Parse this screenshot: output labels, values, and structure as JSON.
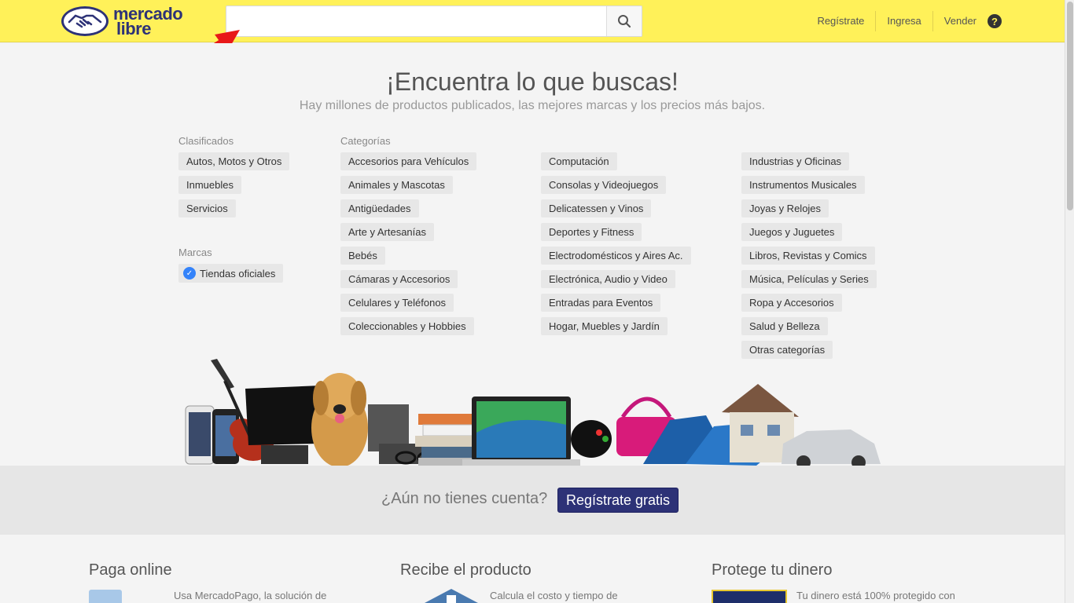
{
  "header": {
    "logo_line1": "mercado",
    "logo_line2": "libre",
    "search_value": "",
    "search_placeholder": "",
    "nav": [
      "Regístrate",
      "Ingresa",
      "Vender"
    ],
    "help_symbol": "?",
    "accent_color": "#fff159",
    "brand_color": "#2d3277"
  },
  "hero": {
    "title": "¡Encuentra lo que buscas!",
    "subtitle": "Hay millones de productos publicados, las mejores marcas y los precios más bajos."
  },
  "clasificados": {
    "title": "Clasificados",
    "items": [
      "Autos, Motos y Otros",
      "Inmuebles",
      "Servicios"
    ]
  },
  "marcas": {
    "title": "Marcas",
    "items": [
      "Tiendas oficiales"
    ]
  },
  "categorias": {
    "title": "Categorías",
    "col1": [
      "Accesorios para Vehículos",
      "Animales y Mascotas",
      "Antigüedades",
      "Arte y Artesanías",
      "Bebés",
      "Cámaras y Accesorios",
      "Celulares y Teléfonos",
      "Coleccionables y Hobbies"
    ],
    "col2": [
      "Computación",
      "Consolas y Videojuegos",
      "Delicatessen y Vinos",
      "Deportes y Fitness",
      "Electrodomésticos y Aires Ac.",
      "Electrónica, Audio y Video",
      "Entradas para Eventos",
      "Hogar, Muebles y Jardín"
    ],
    "col3": [
      "Industrias y Oficinas",
      "Instrumentos Musicales",
      "Joyas y Relojes",
      "Juegos y Juguetes",
      "Libros, Revistas y Comics",
      "Música, Películas y Series",
      "Ropa y Accesorios",
      "Salud y Belleza",
      "Otras categorías"
    ]
  },
  "register_band": {
    "question": "¿Aún no tienes cuenta?",
    "button": "Regístrate gratis"
  },
  "features": [
    {
      "title": "Paga online",
      "text": "Usa MercadoPago, la solución de"
    },
    {
      "title": "Recibe el producto",
      "text": "Calcula el costo y tiempo de"
    },
    {
      "title": "Protege tu dinero",
      "text": "Tu dinero está 100% protegido con"
    }
  ]
}
